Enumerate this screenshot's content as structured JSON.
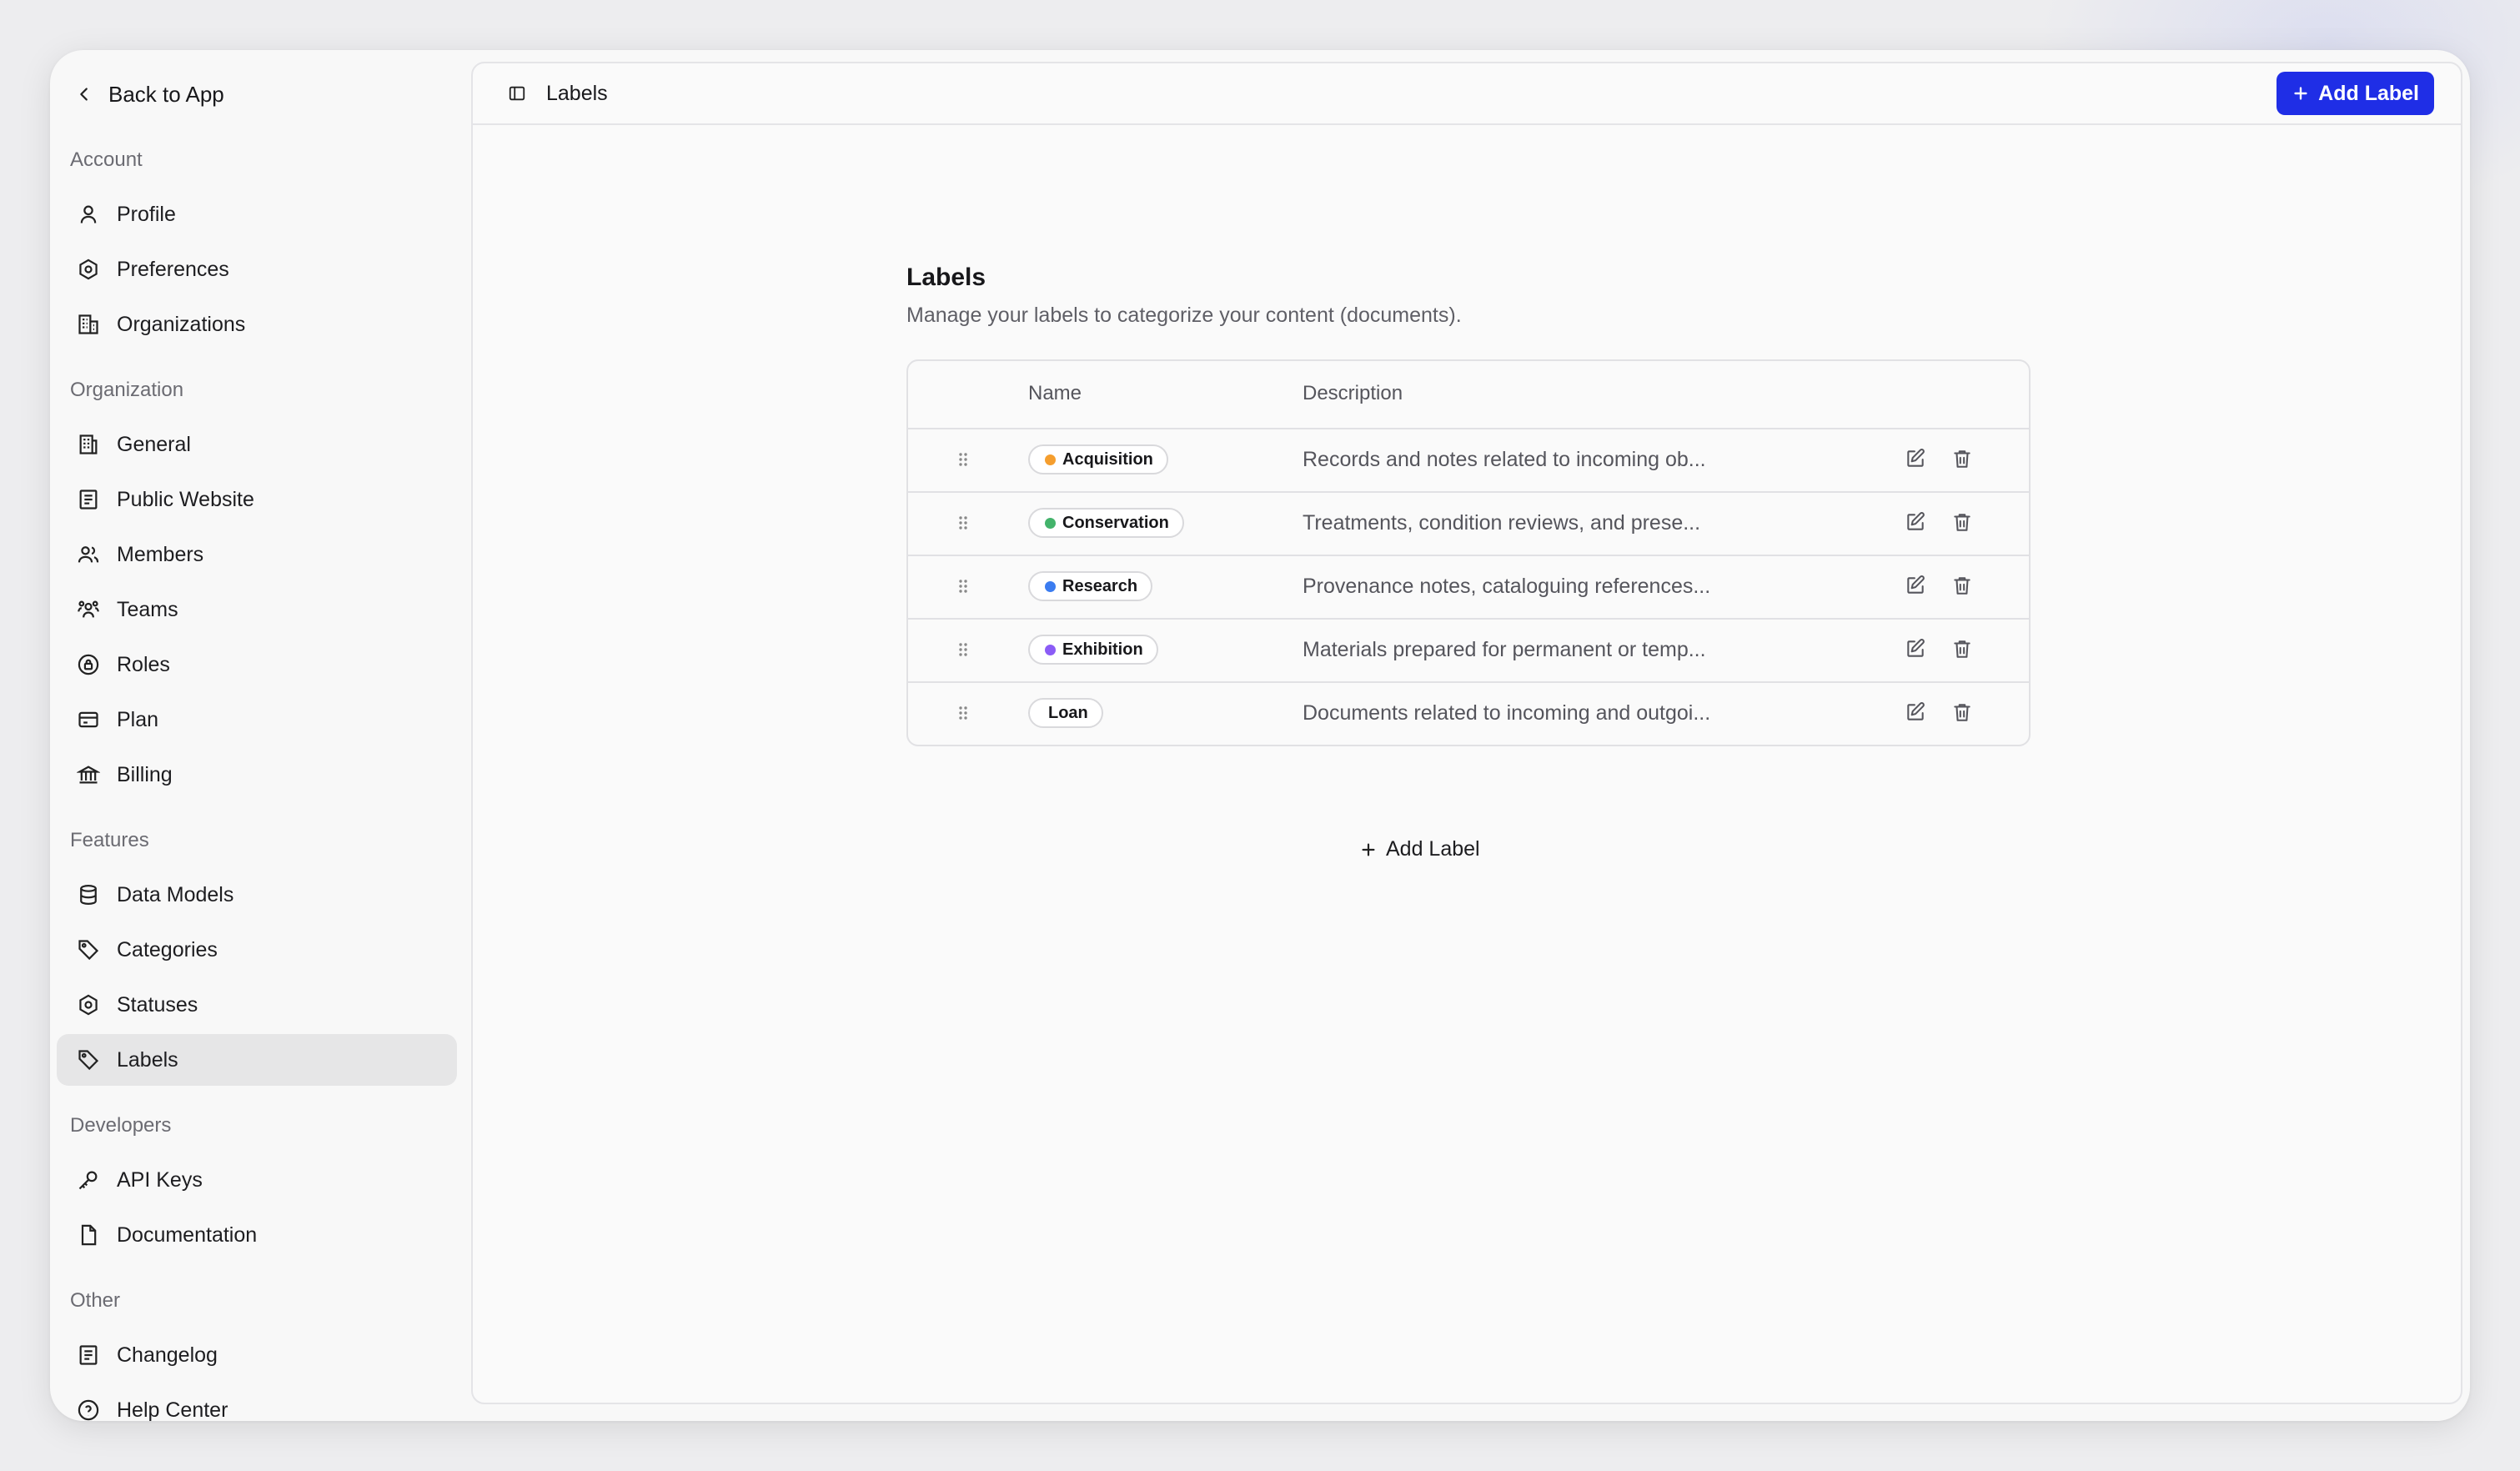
{
  "sidebar": {
    "back_label": "Back to App",
    "groups": {
      "account": "Account",
      "organization": "Organization",
      "features": "Features",
      "developers": "Developers",
      "other": "Other"
    },
    "items": {
      "profile": "Profile",
      "preferences": "Preferences",
      "organizations": "Organizations",
      "general": "General",
      "public_website": "Public Website",
      "members": "Members",
      "teams": "Teams",
      "roles": "Roles",
      "plan": "Plan",
      "billing": "Billing",
      "data_models": "Data Models",
      "categories": "Categories",
      "statuses": "Statuses",
      "labels": "Labels",
      "api_keys": "API Keys",
      "documentation": "Documentation",
      "changelog": "Changelog",
      "help_center": "Help Center"
    },
    "active_item": "labels"
  },
  "header": {
    "title": "Labels",
    "add_button_label": "Add Label"
  },
  "main": {
    "title": "Labels",
    "subtitle": "Manage your labels to categorize your content (documents).",
    "columns": {
      "name": "Name",
      "description": "Description"
    },
    "rows": [
      {
        "name": "Acquisition",
        "color": "#f59e2e",
        "description": "Records and notes related to incoming ob..."
      },
      {
        "name": "Conservation",
        "color": "#43b36b",
        "description": "Treatments, condition reviews, and prese..."
      },
      {
        "name": "Research",
        "color": "#3b7cf0",
        "description": "Provenance notes, cataloguing references..."
      },
      {
        "name": "Exhibition",
        "color": "#8b5cf6",
        "description": "Materials prepared for permanent or temp..."
      },
      {
        "name": "Loan",
        "color": "",
        "description": "Documents related to incoming and outgoi..."
      }
    ],
    "add_inline_label": "Add Label"
  },
  "colors": {
    "accent": "#1f2ee6",
    "active_nav": "#e6e6e7"
  }
}
